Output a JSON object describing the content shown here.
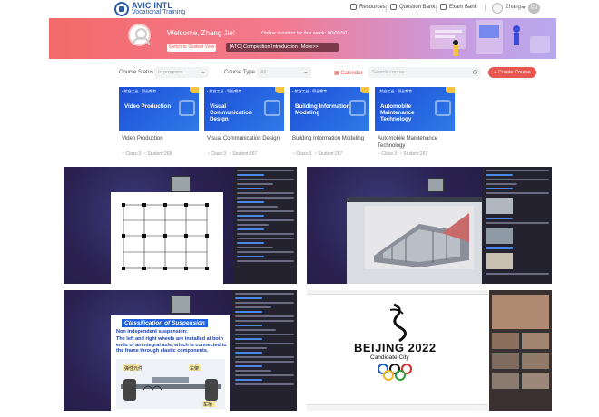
{
  "header": {
    "logo_title": "AVIC INTL",
    "logo_subtitle": "Vocational Training",
    "nav": [
      {
        "label": "Resources",
        "icon": "resources-icon"
      },
      {
        "label": "Question Bank",
        "icon": "question-bank-icon"
      },
      {
        "label": "Exam Bank",
        "icon": "exam-bank-icon"
      }
    ],
    "user_name": "Zhang...",
    "lang": "EN"
  },
  "banner": {
    "welcome": "Welcome, Zhang Jie!",
    "duration": "Online duration for this week: 00:00:50",
    "switch_label": "Switch to Student View",
    "notice": "[ATC] Competition Introduction",
    "more": "More>>"
  },
  "filters": {
    "status_label": "Course Status",
    "status_value": "In progress",
    "type_label": "Course Type",
    "type_value": "All",
    "calendar_label": "Calendar",
    "search_placeholder": "Search course",
    "create_label": "+ Create Course"
  },
  "courses": [
    {
      "title": "Video Production",
      "name": "Video Production",
      "class": "Class:3",
      "students": "Student:268"
    },
    {
      "title": "Visual Communication Design",
      "name": "Visual Communication Design",
      "class": "Class:3",
      "students": "Student:267"
    },
    {
      "title": "Building Information Modeling",
      "name": "Building Information Modeling",
      "class": "Class:3",
      "students": "Student:267"
    },
    {
      "title": "Automobile Maintenance Technology",
      "name": "Automobile Maintenance Technology",
      "class": "Class:3",
      "students": "Student:267"
    }
  ],
  "slide3": {
    "heading": "Classification of Suspension",
    "sub": "Non independent suspension:",
    "body": "The left and right wheels are installed at both ends of an integral axle, which is connected to the frame through elastic components.",
    "label1": "弹性元件",
    "label2": "车架",
    "label3": "车桥"
  },
  "slide4": {
    "city": "BEIJING 2022",
    "sub": "Candidate City"
  }
}
